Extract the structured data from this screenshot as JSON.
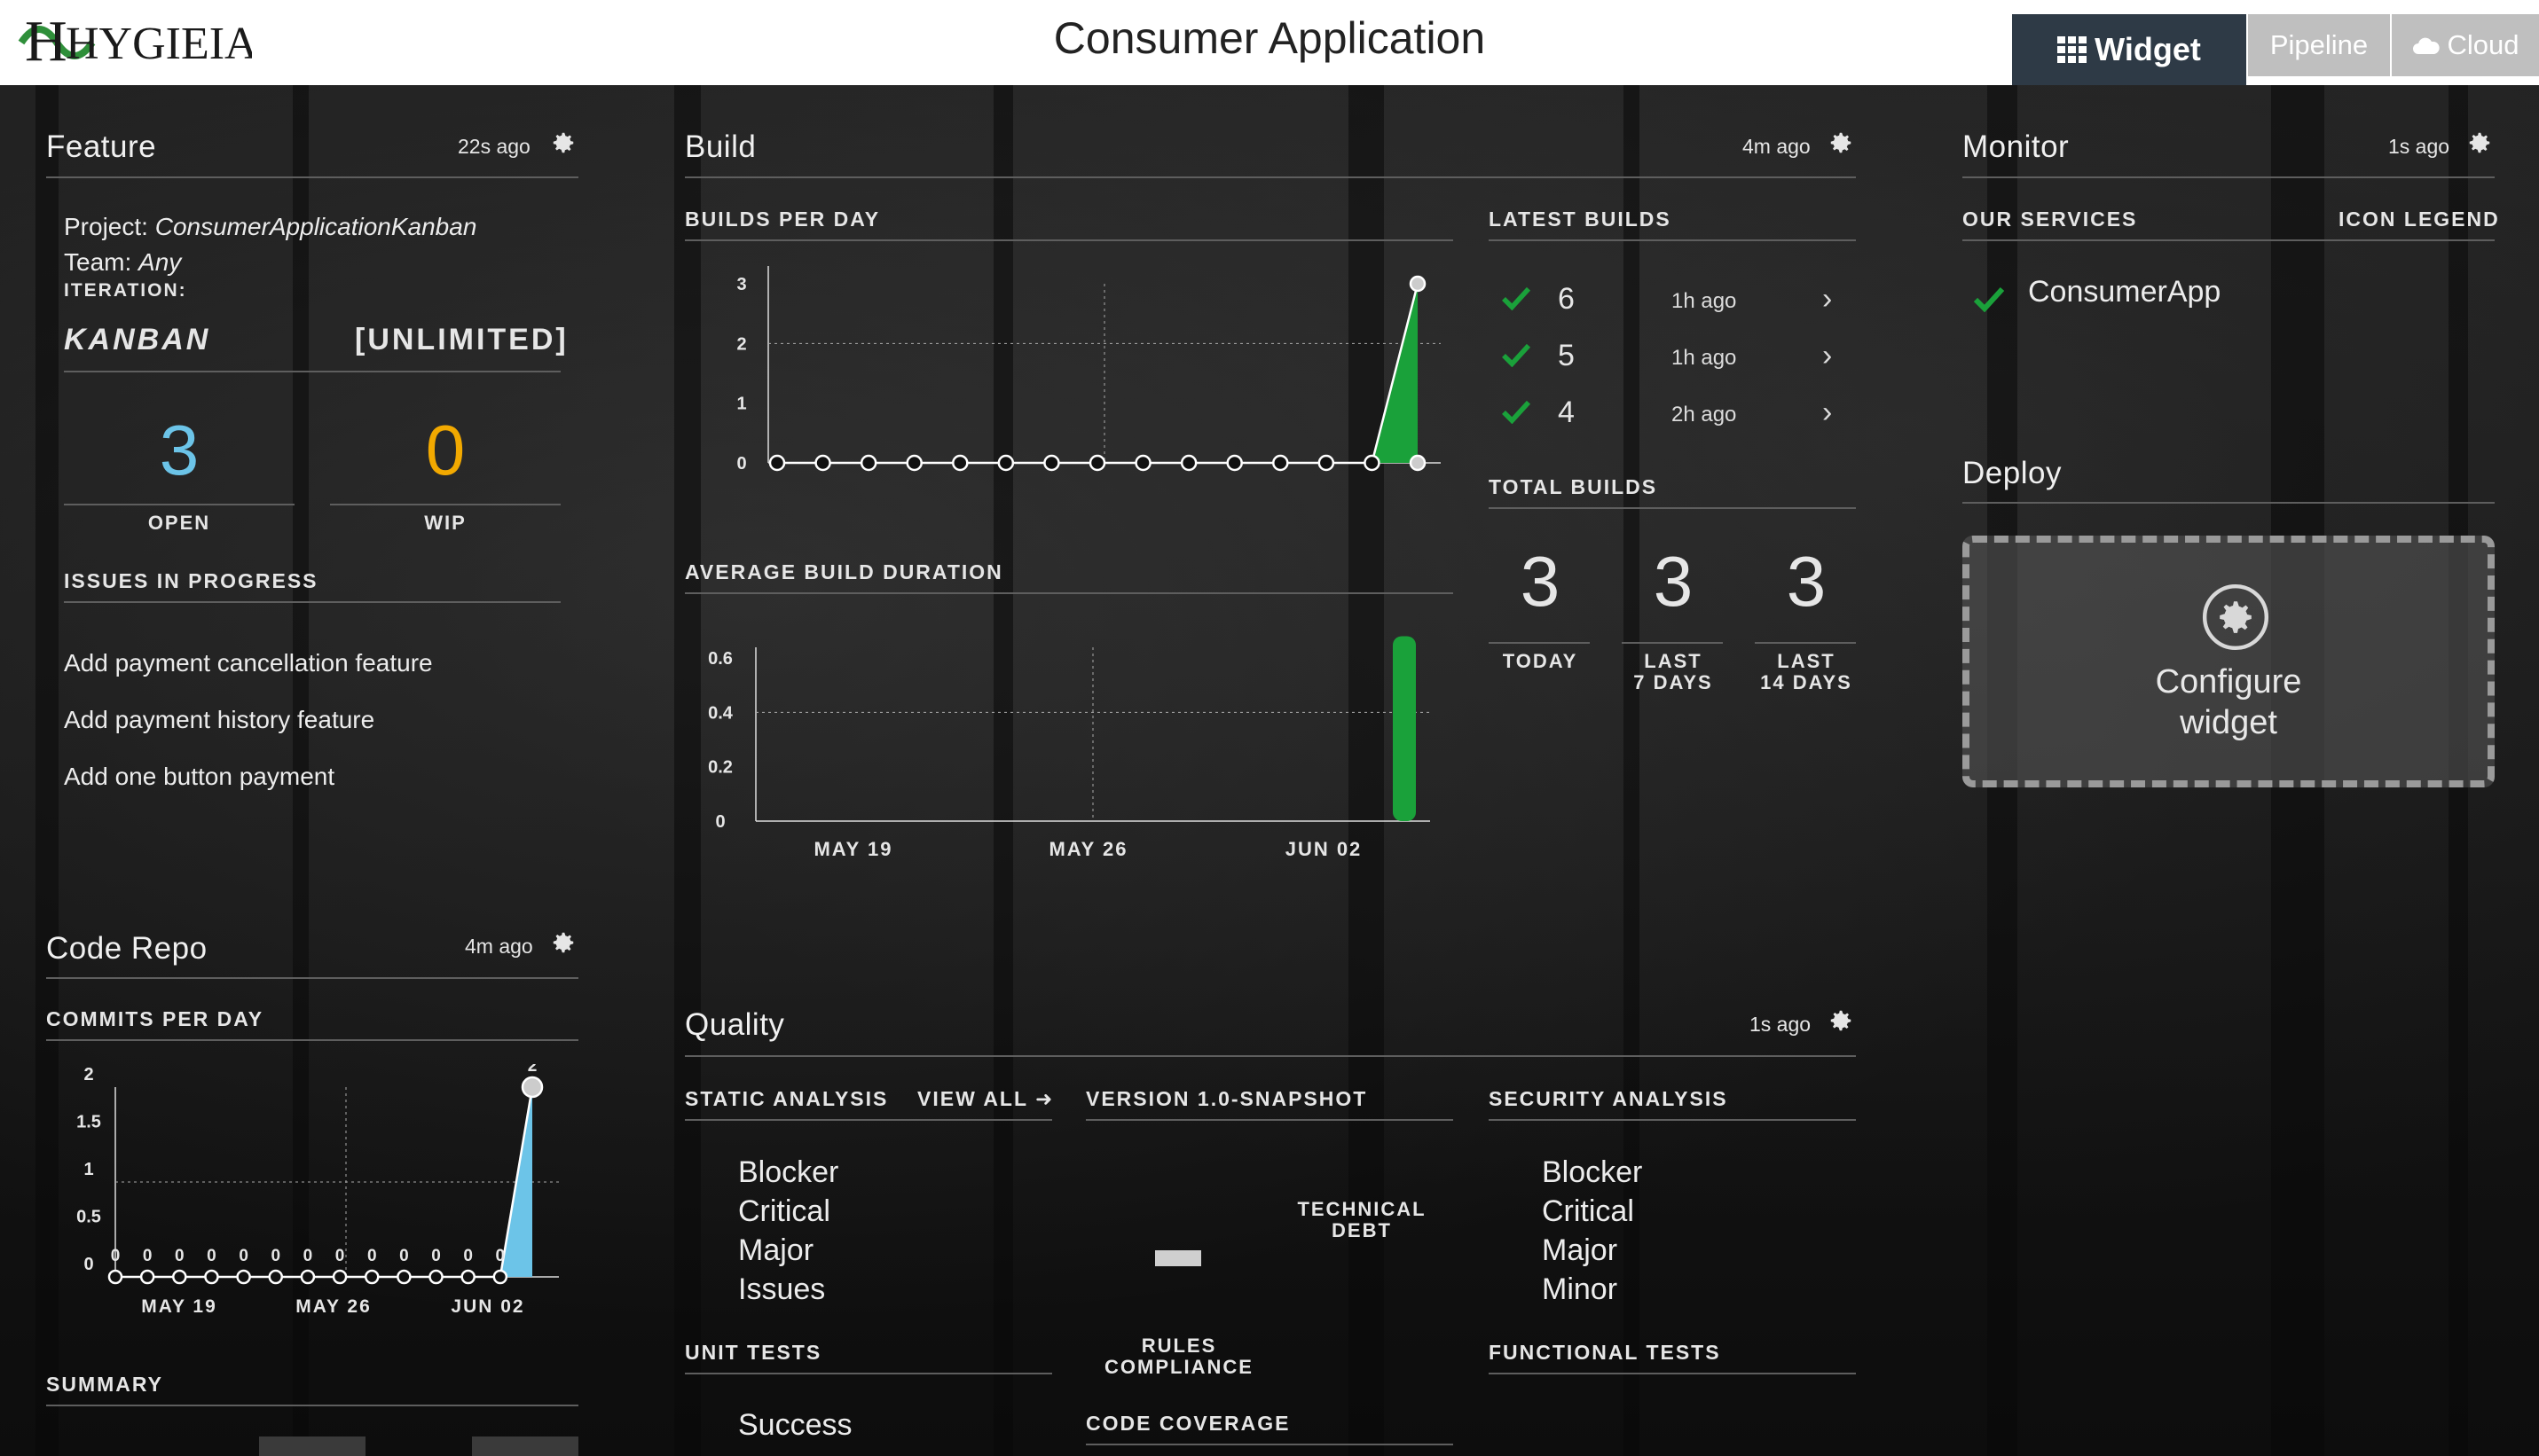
{
  "header": {
    "logo": "HYGIEIA",
    "app_title": "Consumer Application",
    "nav": [
      {
        "label": "Widget",
        "icon": "grid-icon"
      },
      {
        "label": "Pipeline"
      },
      {
        "label": "Cloud",
        "icon": "cloud-icon"
      }
    ]
  },
  "feature": {
    "title": "Feature",
    "age": "22s ago",
    "project_label": "Project:",
    "project": "ConsumerApplicationKanban",
    "team_label": "Team:",
    "team": "Any",
    "iteration_label": "ITERATION:",
    "iteration": "KANBAN",
    "iteration_range": "[UNLIMITED]",
    "open_count": "3",
    "open_label": "OPEN",
    "wip_count": "0",
    "wip_label": "WIP",
    "issues_heading": "ISSUES IN PROGRESS",
    "issues": [
      "Add payment cancellation feature",
      "Add payment history feature",
      "Add one button payment"
    ]
  },
  "code_repo": {
    "title": "Code Repo",
    "age": "4m ago",
    "commits_heading": "COMMITS PER DAY",
    "summary_heading": "SUMMARY"
  },
  "build": {
    "title": "Build",
    "age": "4m ago",
    "builds_per_day_heading": "BUILDS PER DAY",
    "avg_duration_heading": "AVERAGE BUILD DURATION",
    "latest_heading": "LATEST BUILDS",
    "latest": [
      {
        "number": "6",
        "age": "1h ago"
      },
      {
        "number": "5",
        "age": "1h ago"
      },
      {
        "number": "4",
        "age": "2h ago"
      }
    ],
    "total_heading": "TOTAL BUILDS",
    "totals": [
      {
        "value": "3",
        "label": "TODAY"
      },
      {
        "value": "3",
        "label": "LAST\n7 DAYS"
      },
      {
        "value": "3",
        "label": "LAST\n14 DAYS"
      }
    ]
  },
  "monitor": {
    "title": "Monitor",
    "age": "1s ago",
    "services_heading": "OUR SERVICES",
    "legend_heading": "ICON LEGEND",
    "service": "ConsumerApp"
  },
  "deploy": {
    "title": "Deploy",
    "configure_label": "Configure\nwidget"
  },
  "quality": {
    "title": "Quality",
    "age": "1s ago",
    "static_heading": "STATIC ANALYSIS",
    "view_all": "VIEW ALL",
    "static_items": [
      "Blocker",
      "Critical",
      "Major",
      "Issues"
    ],
    "version_heading": "VERSION 1.0-SNAPSHOT",
    "tech_debt_label": "TECHNICAL\nDEBT",
    "rules_label": "RULES\nCOMPLIANCE",
    "code_coverage_heading": "CODE COVERAGE",
    "security_heading": "SECURITY ANALYSIS",
    "security_items": [
      "Blocker",
      "Critical",
      "Major",
      "Minor"
    ],
    "unit_tests_heading": "UNIT TESTS",
    "unit_tests_item": "Success",
    "functional_tests_heading": "FUNCTIONAL TESTS"
  },
  "colors": {
    "green": "#1aa13a",
    "blue": "#6cc4e8",
    "orange": "#f2a900",
    "navy": "#2e3a46"
  },
  "chart_data": [
    {
      "type": "line",
      "title": "BUILDS PER DAY",
      "yticks": [
        "0",
        "1",
        "2",
        "3"
      ],
      "ylim": [
        0,
        3
      ],
      "values": [
        0,
        0,
        0,
        0,
        0,
        0,
        0,
        0,
        0,
        0,
        0,
        0,
        0,
        0,
        3
      ],
      "series": [
        {
          "values": [
            0,
            0,
            0,
            0,
            0,
            0,
            0,
            0,
            0,
            0,
            0,
            0,
            0,
            0,
            3
          ]
        }
      ]
    },
    {
      "type": "bar",
      "title": "AVERAGE BUILD DURATION",
      "yticks": [
        "0",
        "0.2",
        "0.4",
        "0.6"
      ],
      "ylim": [
        0,
        0.6
      ],
      "categories": [
        "MAY 19",
        "MAY 26",
        "JUN 02"
      ],
      "series": [
        {
          "values": [
            0.68
          ]
        }
      ]
    },
    {
      "type": "line",
      "title": "COMMITS PER DAY",
      "yticks": [
        "0",
        "0.5",
        "1",
        "1.5",
        "2"
      ],
      "ylim": [
        0,
        2
      ],
      "categories": [
        "MAY 19",
        "MAY 26",
        "JUN 02"
      ],
      "values": [
        0,
        0,
        0,
        0,
        0,
        0,
        0,
        0,
        0,
        0,
        0,
        0,
        0,
        2
      ],
      "point_labels": [
        "0",
        "0",
        "0",
        "0",
        "0",
        "0",
        "0",
        "0",
        "0",
        "0",
        "0",
        "0",
        "0",
        "2"
      ]
    }
  ]
}
